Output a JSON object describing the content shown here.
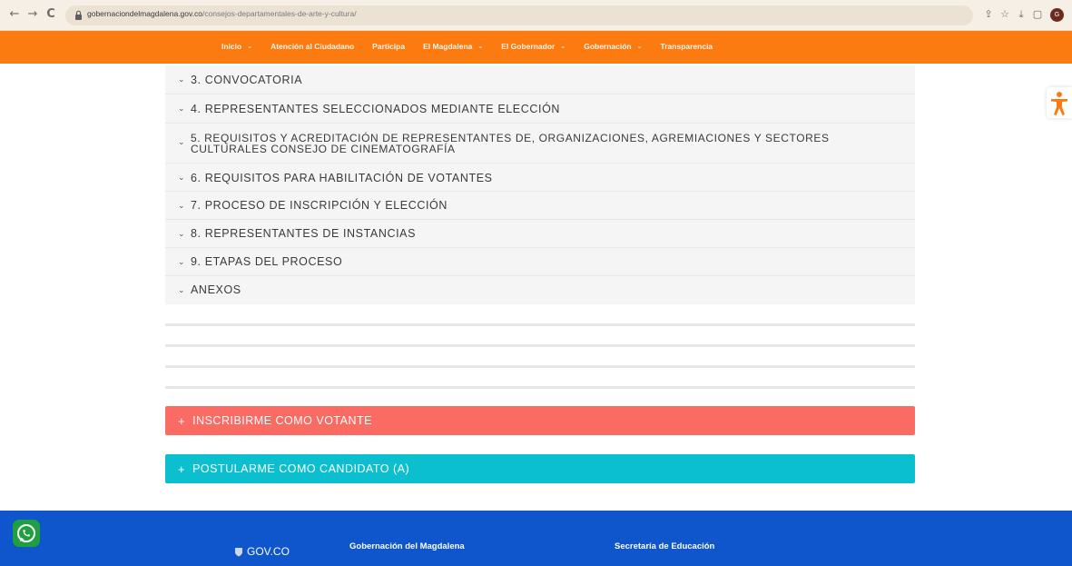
{
  "browser": {
    "url_domain": "gobernaciondelmagdalena.gov.co",
    "url_path": "/consejos-departamentales-de-arte-y-cultura/",
    "profile_initial": "G"
  },
  "topnav": {
    "items": [
      {
        "label": "Inicio",
        "has_dropdown": true
      },
      {
        "label": "Atención al Ciudadano",
        "has_dropdown": false
      },
      {
        "label": "Participa",
        "has_dropdown": false
      },
      {
        "label": "El Magdalena",
        "has_dropdown": true
      },
      {
        "label": "El Gobernador",
        "has_dropdown": true
      },
      {
        "label": "Gobernación",
        "has_dropdown": true
      },
      {
        "label": "Transparencia",
        "has_dropdown": false
      }
    ]
  },
  "accordion": {
    "items": [
      {
        "label": "3. CONVOCATORIA"
      },
      {
        "label": "4. REPRESENTANTES SELECCIONADOS MEDIANTE ELECCIÓN"
      },
      {
        "label_line1": "5. REQUISITOS Y ACREDITACIÓN DE REPRESENTANTES DE, ORGANIZACIONES, AGREMIACIONES Y SECTORES",
        "label_line2": "CULTURALES CONSEJO DE CINEMATOGRAFÍA"
      },
      {
        "label": "6. REQUISITOS PARA HABILITACIÓN DE VOTANTES"
      },
      {
        "label": "7. PROCESO DE INSCRIPCIÓN Y ELECCIÓN"
      },
      {
        "label": "8. REPRESENTANTES DE INSTANCIAS"
      },
      {
        "label": "9. ETAPAS DEL PROCESO"
      },
      {
        "label": "ANEXOS"
      }
    ]
  },
  "actions": {
    "votante_label": "INSCRIBIRME COMO VOTANTE",
    "candidato_label": "POSTULARME COMO CANDIDATO (A)",
    "plus_symbol": "+"
  },
  "footer": {
    "govco": "GOV.CO",
    "col1_title": "Gobernación del Magdalena",
    "col2_title": "Secretaría de Educación"
  },
  "colors": {
    "nav_orange": "#fb7b10",
    "votante_red": "#f96b63",
    "candidato_teal": "#0cbfcf",
    "footer_blue": "#0f55cc"
  }
}
